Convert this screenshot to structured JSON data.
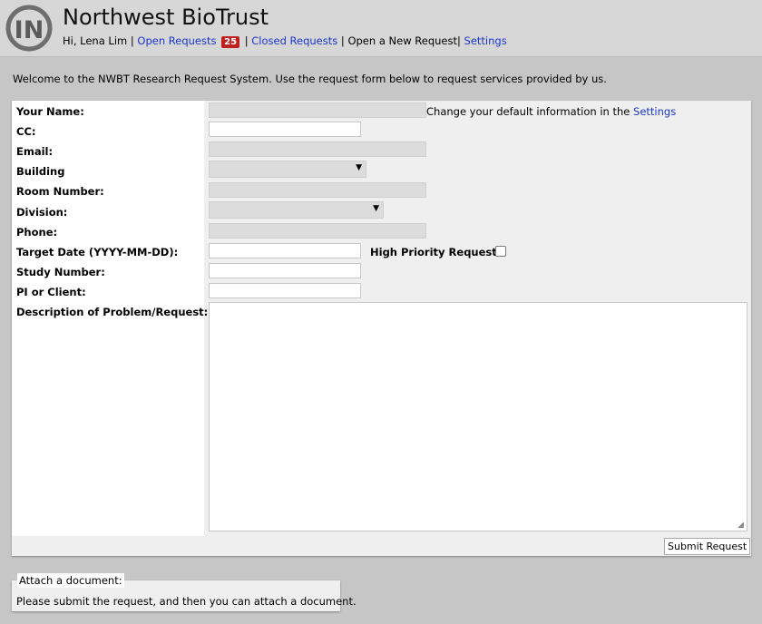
{
  "header": {
    "title": "Northwest BioTrust",
    "greeting": "Hi, Lena Lim",
    "open_requests": "Open Requests",
    "open_count": "25",
    "closed_requests": "Closed Requests",
    "new_request": "Open a New Request",
    "settings": "Settings",
    "sep": "|"
  },
  "welcome": "Welcome to the NWBT Research Request System. Use the request form below to request services provided by us.",
  "form": {
    "labels": {
      "name": "Your Name:",
      "cc": "CC:",
      "email": "Email:",
      "building": "Building",
      "room": "Room Number:",
      "division": "Division:",
      "phone": "Phone:",
      "target_date": "Target Date (YYYY-MM-DD):",
      "study": "Study Number:",
      "pi": "PI or Client:",
      "description": "Description of Problem/Request:"
    },
    "values": {
      "name": "",
      "cc": "",
      "email": "",
      "building": "",
      "room": "",
      "division": "",
      "phone": "",
      "target_date": "",
      "study": "",
      "pi": "",
      "description": ""
    },
    "settings_note_prefix": "Change your default information in the ",
    "settings_link": "Settings",
    "high_priority": "High Priority Request:",
    "high_priority_checked": false,
    "submit": "Submit Request"
  },
  "attach": {
    "legend": "Attach a document:",
    "message": "Please submit the request, and then you can attach a document."
  },
  "icons": {
    "logo": "in-logo-icon",
    "dropdown": "chevron-down-icon",
    "resize": "resize-grip-icon"
  },
  "colors": {
    "link": "#1a36c8",
    "badge": "#c0201d",
    "background": "#c6c6c6"
  }
}
